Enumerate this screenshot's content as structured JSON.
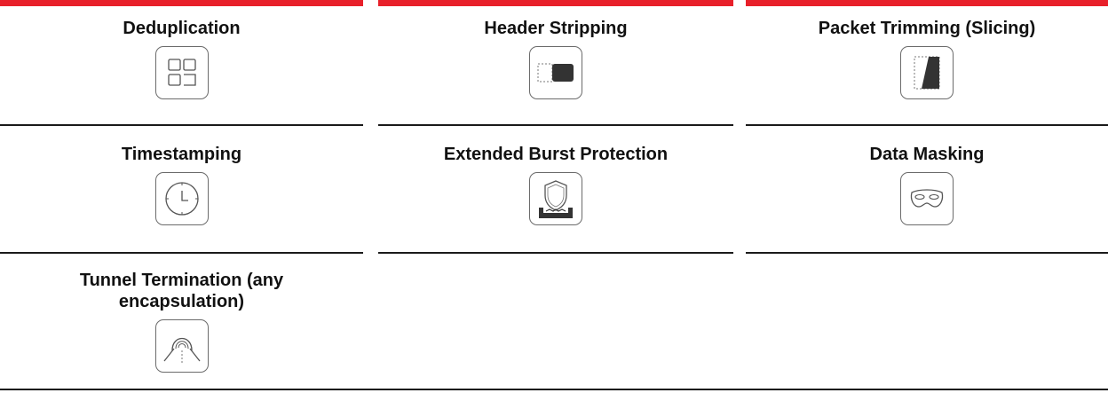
{
  "features": [
    {
      "title": "Deduplication",
      "icon": "grid-squares-icon"
    },
    {
      "title": "Header Stripping",
      "icon": "header-strip-icon"
    },
    {
      "title": "Packet Trimming (Slicing)",
      "icon": "packet-slice-icon"
    },
    {
      "title": "Timestamping",
      "icon": "clock-icon"
    },
    {
      "title": "Extended Burst Protection",
      "icon": "shield-icon"
    },
    {
      "title": "Data Masking",
      "icon": "mask-icon"
    },
    {
      "title": "Tunnel Termination (any encapsulation)",
      "icon": "tunnel-icon"
    }
  ],
  "colors": {
    "accent": "#e8202a",
    "divider": "#1a1a1a",
    "icon_stroke": "#555555"
  }
}
